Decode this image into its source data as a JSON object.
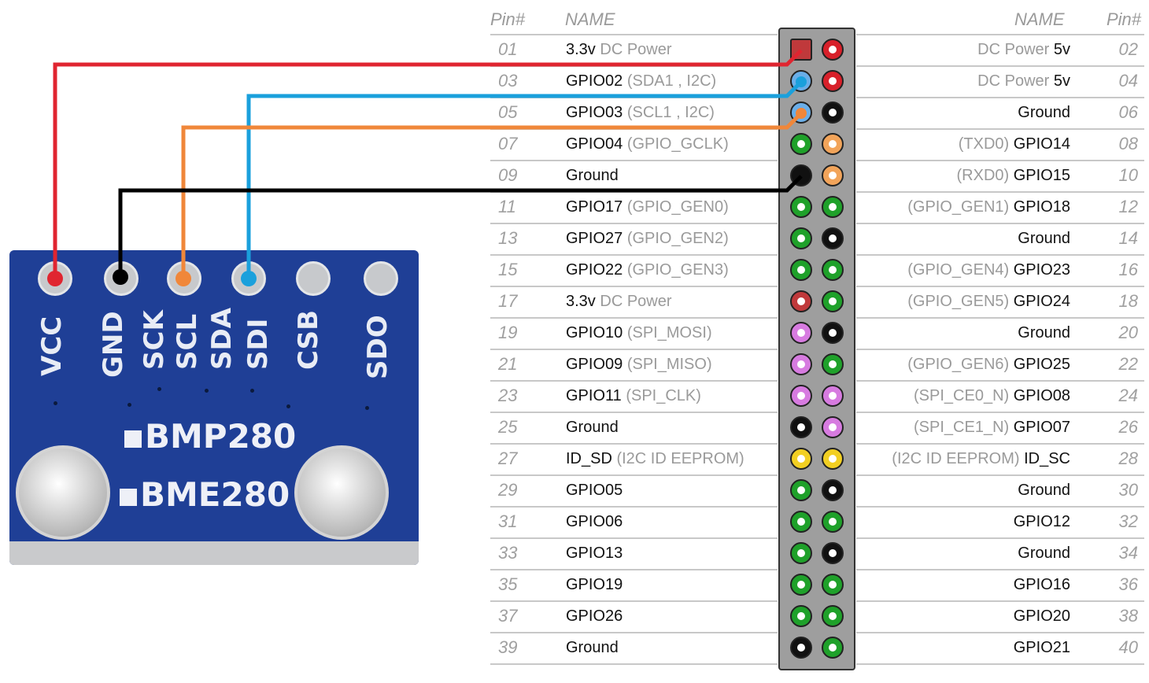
{
  "table": {
    "left_headers": {
      "pin": "Pin#",
      "name": "NAME"
    },
    "right_headers": {
      "pin": "Pin#",
      "name": "NAME"
    },
    "rows": [
      {
        "l_pin": "01",
        "l_main": "3.3v",
        "l_sub": " DC Power",
        "l_pre": "",
        "r_pre": "DC Power ",
        "r_main": "5v",
        "r_sub": "",
        "r_pin": "02"
      },
      {
        "l_pin": "03",
        "l_main": "GPIO02",
        "l_sub": " (SDA1 , I2C)",
        "l_pre": "",
        "r_pre": "DC Power ",
        "r_main": "5v",
        "r_sub": "",
        "r_pin": "04"
      },
      {
        "l_pin": "05",
        "l_main": "GPIO03",
        "l_sub": " (SCL1 , I2C)",
        "l_pre": "",
        "r_pre": "",
        "r_main": "Ground",
        "r_sub": "",
        "r_pin": "06"
      },
      {
        "l_pin": "07",
        "l_main": "GPIO04",
        "l_sub": " (GPIO_GCLK)",
        "l_pre": "",
        "r_pre": "(TXD0) ",
        "r_main": "GPIO14",
        "r_sub": "",
        "r_pin": "08"
      },
      {
        "l_pin": "09",
        "l_main": "Ground",
        "l_sub": "",
        "l_pre": "",
        "r_pre": "(RXD0) ",
        "r_main": "GPIO15",
        "r_sub": "",
        "r_pin": "10"
      },
      {
        "l_pin": "11",
        "l_main": "GPIO17",
        "l_sub": " (GPIO_GEN0)",
        "l_pre": "",
        "r_pre": "(GPIO_GEN1) ",
        "r_main": "GPIO18",
        "r_sub": "",
        "r_pin": "12"
      },
      {
        "l_pin": "13",
        "l_main": "GPIO27",
        "l_sub": " (GPIO_GEN2)",
        "l_pre": "",
        "r_pre": "",
        "r_main": "Ground",
        "r_sub": "",
        "r_pin": "14"
      },
      {
        "l_pin": "15",
        "l_main": "GPIO22",
        "l_sub": " (GPIO_GEN3)",
        "l_pre": "",
        "r_pre": "(GPIO_GEN4) ",
        "r_main": "GPIO23",
        "r_sub": "",
        "r_pin": "16"
      },
      {
        "l_pin": "17",
        "l_main": "3.3v",
        "l_sub": " DC Power",
        "l_pre": "",
        "r_pre": "(GPIO_GEN5) ",
        "r_main": "GPIO24",
        "r_sub": "",
        "r_pin": "18"
      },
      {
        "l_pin": "19",
        "l_main": "GPIO10",
        "l_sub": " (SPI_MOSI)",
        "l_pre": "",
        "r_pre": "",
        "r_main": "Ground",
        "r_sub": "",
        "r_pin": "20"
      },
      {
        "l_pin": "21",
        "l_main": "GPIO09",
        "l_sub": " (SPI_MISO)",
        "l_pre": "",
        "r_pre": "(GPIO_GEN6) ",
        "r_main": "GPIO25",
        "r_sub": "",
        "r_pin": "22"
      },
      {
        "l_pin": "23",
        "l_main": "GPIO11",
        "l_sub": " (SPI_CLK)",
        "l_pre": "",
        "r_pre": "(SPI_CE0_N) ",
        "r_main": "GPIO08",
        "r_sub": "",
        "r_pin": "24"
      },
      {
        "l_pin": "25",
        "l_main": "Ground",
        "l_sub": "",
        "l_pre": "",
        "r_pre": "(SPI_CE1_N) ",
        "r_main": "GPIO07",
        "r_sub": "",
        "r_pin": "26"
      },
      {
        "l_pin": "27",
        "l_main": "ID_SD",
        "l_sub": " (I2C ID EEPROM)",
        "l_pre": "",
        "r_pre": "(I2C ID EEPROM) ",
        "r_main": "ID_SC",
        "r_sub": "",
        "r_pin": "28"
      },
      {
        "l_pin": "29",
        "l_main": "GPIO05",
        "l_sub": "",
        "l_pre": "",
        "r_pre": "",
        "r_main": "Ground",
        "r_sub": "",
        "r_pin": "30"
      },
      {
        "l_pin": "31",
        "l_main": "GPIO06",
        "l_sub": "",
        "l_pre": "",
        "r_pre": "",
        "r_main": "GPIO12",
        "r_sub": "",
        "r_pin": "32"
      },
      {
        "l_pin": "33",
        "l_main": "GPIO13",
        "l_sub": "",
        "l_pre": "",
        "r_pre": "",
        "r_main": "Ground",
        "r_sub": "",
        "r_pin": "34"
      },
      {
        "l_pin": "35",
        "l_main": "GPIO19",
        "l_sub": "",
        "l_pre": "",
        "r_pre": "",
        "r_main": "GPIO16",
        "r_sub": "",
        "r_pin": "36"
      },
      {
        "l_pin": "37",
        "l_main": "GPIO26",
        "l_sub": "",
        "l_pre": "",
        "r_pre": "",
        "r_main": "GPIO20",
        "r_sub": "",
        "r_pin": "38"
      },
      {
        "l_pin": "39",
        "l_main": "Ground",
        "l_sub": "",
        "l_pre": "",
        "r_pre": "",
        "r_main": "GPIO21",
        "r_sub": "",
        "r_pin": "40"
      }
    ]
  },
  "pin_colors": {
    "power33": "#c0393b",
    "power5": "#d8202a",
    "ground": "#111111",
    "gpio": "#1fa12a",
    "i2c": "#6aaee8",
    "uart": "#f2a45a",
    "spi": "#d77be0",
    "eeprom": "#f2cf22"
  },
  "header_pins": [
    [
      "power33_sq",
      "power5"
    ],
    [
      "i2c",
      "power5"
    ],
    [
      "i2c",
      "ground"
    ],
    [
      "gpio",
      "uart"
    ],
    [
      "ground_solid",
      "uart"
    ],
    [
      "gpio",
      "gpio"
    ],
    [
      "gpio",
      "ground"
    ],
    [
      "gpio",
      "gpio"
    ],
    [
      "power33",
      "gpio"
    ],
    [
      "spi",
      "ground"
    ],
    [
      "spi",
      "gpio"
    ],
    [
      "spi",
      "spi"
    ],
    [
      "ground",
      "spi"
    ],
    [
      "eeprom",
      "eeprom"
    ],
    [
      "gpio",
      "ground"
    ],
    [
      "gpio",
      "gpio"
    ],
    [
      "gpio",
      "ground"
    ],
    [
      "gpio",
      "gpio"
    ],
    [
      "gpio",
      "gpio"
    ],
    [
      "ground",
      "gpio"
    ]
  ],
  "sensor": {
    "pins": [
      "VCC",
      "GND",
      "SCK",
      "SCL",
      "SDA",
      "SDI",
      "CSB",
      "SDO"
    ],
    "silk_labels": [
      "VCC",
      "GND",
      "SCK",
      "SCL",
      "SDA",
      "SDI",
      "CSB",
      "SDO"
    ],
    "chip_labels": [
      "BMP280",
      "BME280"
    ]
  },
  "wires": [
    {
      "name": "vcc-wire",
      "from": "VCC",
      "to_pin": "01",
      "color": "#e02530"
    },
    {
      "name": "sda-wire",
      "from": "SDA",
      "to_pin": "03",
      "color": "#1aa0dc"
    },
    {
      "name": "scl-wire",
      "from": "SCL",
      "to_pin": "05",
      "color": "#f0873a"
    },
    {
      "name": "gnd-wire",
      "from": "GND",
      "to_pin": "09",
      "color": "#000000"
    }
  ]
}
